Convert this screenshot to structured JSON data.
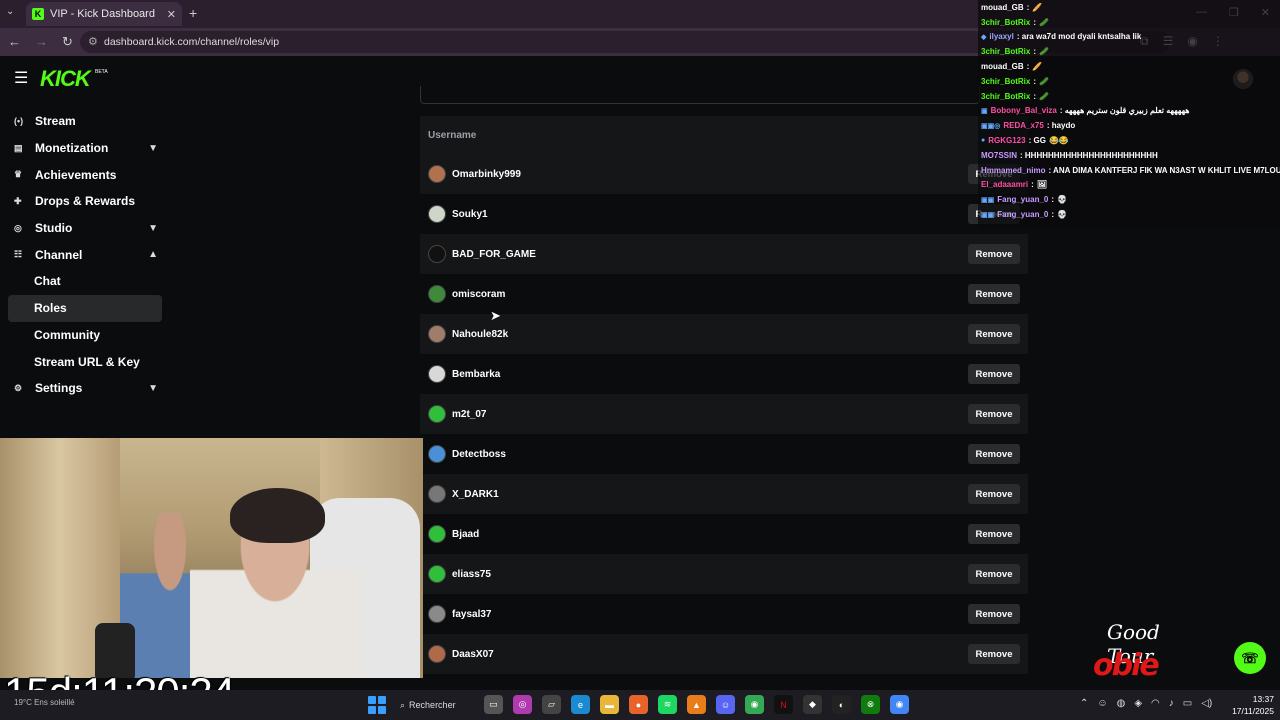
{
  "browser": {
    "tab_title": "VIP - Kick Dashboard",
    "tab_favicon": "K",
    "url": "dashboard.kick.com/channel/roles/vip"
  },
  "header": {
    "logo": "KICK",
    "logo_badge": "BETA"
  },
  "sidebar": {
    "items": [
      {
        "label": "Stream",
        "icon": "stream-icon",
        "glyph": "(•)"
      },
      {
        "label": "Monetization",
        "icon": "monetization-icon",
        "glyph": "▤",
        "chevron": "down"
      },
      {
        "label": "Achievements",
        "icon": "trophy-icon",
        "glyph": "♛"
      },
      {
        "label": "Drops & Rewards",
        "icon": "gift-icon",
        "glyph": "✚"
      },
      {
        "label": "Studio",
        "icon": "studio-icon",
        "glyph": "◎",
        "chevron": "down"
      },
      {
        "label": "Channel",
        "icon": "channel-icon",
        "glyph": "☷",
        "chevron": "up"
      },
      {
        "label": "Chat",
        "sub": true
      },
      {
        "label": "Roles",
        "sub": true,
        "active": true
      },
      {
        "label": "Community",
        "sub": true
      },
      {
        "label": "Stream URL & Key",
        "sub": true
      },
      {
        "label": "Settings",
        "icon": "gear-icon",
        "glyph": "⚙",
        "chevron": "down"
      }
    ]
  },
  "vip_table": {
    "column_username": "Username",
    "remove_label": "Remove",
    "rows": [
      {
        "username": "Omarbinky999",
        "avatar_color": "#b0714f"
      },
      {
        "username": "Souky1",
        "avatar_color": "#cfd5c8"
      },
      {
        "username": "BAD_FOR_GAME",
        "avatar_color": "#111111"
      },
      {
        "username": "omiscoram",
        "avatar_color": "#3e8a3a"
      },
      {
        "username": "Nahoule82k",
        "avatar_color": "#a07c6a"
      },
      {
        "username": "Bembarka",
        "avatar_color": "#d8d8d8"
      },
      {
        "username": "m2t_07",
        "avatar_color": "#2fbf3a"
      },
      {
        "username": "Detectboss",
        "avatar_color": "#4a90d9"
      },
      {
        "username": "X_DARK1",
        "avatar_color": "#777777"
      },
      {
        "username": "Bjaad",
        "avatar_color": "#2fbf3a"
      },
      {
        "username": "eliass75",
        "avatar_color": "#2fbf3a"
      },
      {
        "username": "faysal37",
        "avatar_color": "#8a8a8a"
      },
      {
        "username": "DaasX07",
        "avatar_color": "#b06a4a"
      }
    ]
  },
  "chat_overlay": {
    "lines": [
      {
        "user": "mouad_GB",
        "color": "#ffffff",
        "msg": ":",
        "emote": "🥖"
      },
      {
        "user": "3chir_BotRix",
        "color": "#53fc18",
        "msg": ":",
        "emote": "🥒"
      },
      {
        "user": "ilyaxyl",
        "color": "#9aa7ff",
        "msg": ": ara wa7d mod dyali kntsalha lik",
        "badge": "◆"
      },
      {
        "user": "3chir_BotRix",
        "color": "#53fc18",
        "msg": ":",
        "emote": "🥒"
      },
      {
        "user": "mouad_GB",
        "color": "#ffffff",
        "msg": ":",
        "emote": "🥖"
      },
      {
        "user": "3chir_BotRix",
        "color": "#53fc18",
        "msg": ":",
        "emote": "🥒"
      },
      {
        "user": "3chir_BotRix",
        "color": "#53fc18",
        "msg": ":",
        "emote": "🥒"
      },
      {
        "user": "Bobony_Bal_viza",
        "color": "#ff4fa3",
        "msg": ": هههههه تعلم زبيري قلون ستريم ههههه",
        "badge": "▣"
      },
      {
        "user": "REDA_x75",
        "color": "#ff4fa3",
        "msg": ": haydo",
        "badge": "▣▣◎"
      },
      {
        "user": "RGKG123",
        "color": "#ff4fa3",
        "msg": ": GG",
        "badge": "●",
        "emote": "😂😂"
      },
      {
        "user": "MO7SSIN",
        "color": "#c79bff",
        "msg": ": HHHHHHHHHHHHHHHHHHHHHHH"
      },
      {
        "user": "Hmmamed_nimo",
        "color": "#c79bff",
        "msg": ": ANA DIMA KANTFERJ FIK WA N3AST W KHLIT LIVE M7LOUL"
      },
      {
        "user": "El_adaaamri",
        "color": "#ff4fa3",
        "msg": ":",
        "emote": "🖼"
      },
      {
        "user": "Fang_yuan_0",
        "color": "#c79bff",
        "msg": ":",
        "badge": "▣▣",
        "emote": "💀"
      },
      {
        "user": "Fang_yuan_0",
        "color": "#c79bff",
        "msg": ":",
        "badge": "▣▣",
        "emote": "💀"
      }
    ]
  },
  "overlay": {
    "timer": "15d:11:20:24",
    "brand_signature": "Good Tour",
    "brand_name": "obie"
  },
  "taskbar": {
    "weather": "19°C Ens soleillé",
    "search_label": "Rechercher",
    "time": "13:37",
    "date": "17/11/2025"
  }
}
